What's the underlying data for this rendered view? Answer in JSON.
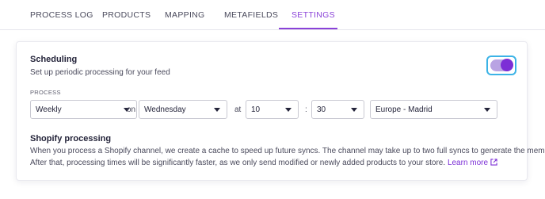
{
  "tabs": [
    {
      "label": "PROCESS LOG"
    },
    {
      "label": "PRODUCTS"
    },
    {
      "label": "MAPPING"
    },
    {
      "label": "METAFIELDS"
    },
    {
      "label": "SETTINGS"
    }
  ],
  "active_tab": "SETTINGS",
  "accent_color": "#8a42d8",
  "scheduling": {
    "title": "Scheduling",
    "description": "Set up periodic processing for your feed",
    "toggle_on": true,
    "process_label": "PROCESS",
    "frequency": "Weekly",
    "on_label": "on",
    "day": "Wednesday",
    "at_label": "at",
    "hour": "10",
    "colon": ":",
    "minute": "30",
    "timezone": "Europe - Madrid"
  },
  "shopify": {
    "title": "Shopify processing",
    "line1": "When you process a Shopify channel, we create a cache to speed up future syncs. The channel may take up to two full syncs to generate the memory.",
    "line2": "After that, processing times will be significantly faster, as we only send modified or newly added products to your store.",
    "link_label": "Learn more",
    "link_icon": "external-link-icon"
  }
}
